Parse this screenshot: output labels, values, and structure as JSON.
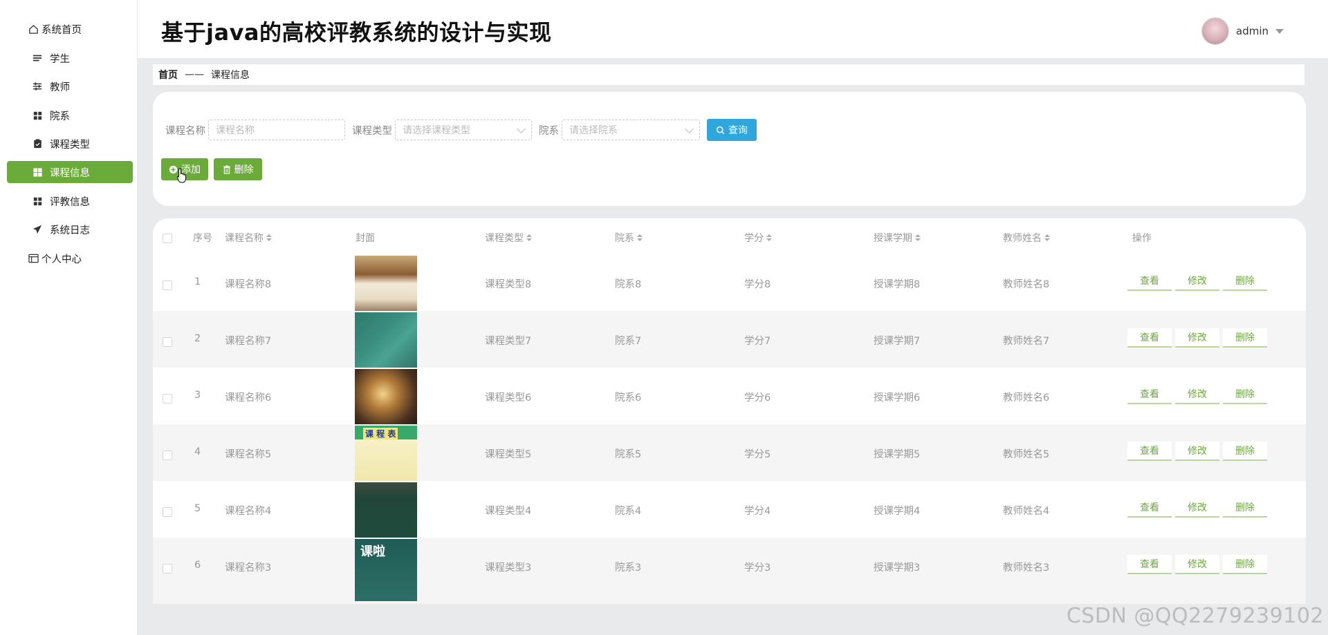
{
  "app": {
    "title": "基于java的高校评教系统的设计与实现",
    "username": "admin"
  },
  "sidebar": {
    "items": [
      {
        "label": "系统首页",
        "icon": "home-icon"
      },
      {
        "label": "学生",
        "icon": "list-icon"
      },
      {
        "label": "教师",
        "icon": "sliders-icon"
      },
      {
        "label": "院系",
        "icon": "grid-icon"
      },
      {
        "label": "课程类型",
        "icon": "clipboard-icon"
      },
      {
        "label": "课程信息",
        "icon": "grid-icon",
        "active": true
      },
      {
        "label": "评教信息",
        "icon": "grid-icon"
      },
      {
        "label": "系统日志",
        "icon": "send-icon"
      },
      {
        "label": "个人中心",
        "icon": "card-icon"
      }
    ]
  },
  "breadcrumb": {
    "home": "首页",
    "sep": "——",
    "current": "课程信息"
  },
  "search": {
    "course_name_label": "课程名称",
    "course_name_placeholder": "课程名称",
    "course_type_label": "课程类型",
    "course_type_placeholder": "请选择课程类型",
    "dept_label": "院系",
    "dept_placeholder": "请选择院系",
    "query_label": "查询",
    "add_label": "添加",
    "delete_label": "删除"
  },
  "table": {
    "headers": {
      "index": "序号",
      "name": "课程名称",
      "cover": "封面",
      "type": "课程类型",
      "dept": "院系",
      "credit": "学分",
      "term": "授课学期",
      "teacher": "教师姓名",
      "ops": "操作"
    },
    "ops": {
      "view": "查看",
      "edit": "修改",
      "delete": "删除"
    },
    "rows": [
      {
        "index": "1",
        "name": "课程名称8",
        "type": "课程类型8",
        "dept": "院系8",
        "credit": "学分8",
        "term": "授课学期8",
        "teacher": "教师姓名8"
      },
      {
        "index": "2",
        "name": "课程名称7",
        "type": "课程类型7",
        "dept": "院系7",
        "credit": "学分7",
        "term": "授课学期7",
        "teacher": "教师姓名7"
      },
      {
        "index": "3",
        "name": "课程名称6",
        "type": "课程类型6",
        "dept": "院系6",
        "credit": "学分6",
        "term": "授课学期6",
        "teacher": "教师姓名6"
      },
      {
        "index": "4",
        "name": "课程名称5",
        "type": "课程类型5",
        "dept": "院系5",
        "credit": "学分5",
        "term": "授课学期5",
        "teacher": "教师姓名5"
      },
      {
        "index": "5",
        "name": "课程名称4",
        "type": "课程类型4",
        "dept": "院系4",
        "credit": "学分4",
        "term": "授课学期4",
        "teacher": "教师姓名4"
      },
      {
        "index": "6",
        "name": "课程名称3",
        "type": "课程类型3",
        "dept": "院系3",
        "credit": "学分3",
        "term": "授课学期3",
        "teacher": "教师姓名3"
      }
    ]
  },
  "cover_image_texts": {
    "timetable": "课 程 表",
    "class_start": "课啦"
  },
  "watermark": "CSDN @QQ2279239102",
  "colors": {
    "accent_green": "#6aab3a",
    "query_blue": "#2fa7dc",
    "bg_gray": "#e9eaec"
  }
}
